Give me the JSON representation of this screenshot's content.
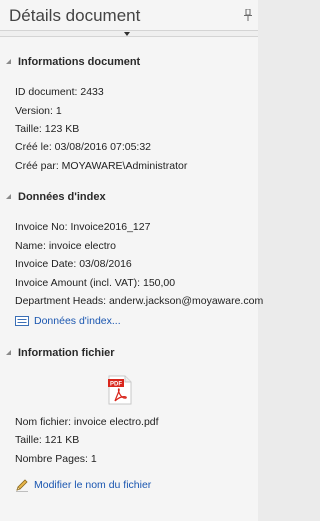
{
  "panel": {
    "title": "Détails document",
    "pin_icon": "pin-icon",
    "splitter_icon": "chevron-down-icon"
  },
  "sections": {
    "doc_info": {
      "title": "Informations document",
      "rows": [
        "ID document: 2433",
        "Version: 1",
        "Taille: 123 KB",
        "Créé le: 03/08/2016 07:05:32",
        "Créé par: MOYAWARE\\Administrator"
      ]
    },
    "index_data": {
      "title": "Données d'index",
      "rows": [
        "Invoice No: Invoice2016_127",
        "Name: invoice electro",
        "Invoice Date: 03/08/2016",
        "Invoice Amount (incl. VAT): 150,00",
        "Department Heads: anderw.jackson@moyaware.com"
      ],
      "link_label": "Données d'index...",
      "link_icon": "list-icon"
    },
    "file_info": {
      "title": "Information fichier",
      "file_icon": "pdf-file-icon",
      "pdf_badge": "PDF",
      "rows": [
        "Nom fichier: invoice electro.pdf",
        "Taille: 121 KB",
        "Nombre Pages: 1"
      ],
      "link_label": "Modifier le nom du fichier",
      "link_icon": "pencil-icon"
    }
  },
  "colors": {
    "link": "#1a56b0",
    "background": "#f5f5f5",
    "pdf_red": "#d9261c"
  }
}
